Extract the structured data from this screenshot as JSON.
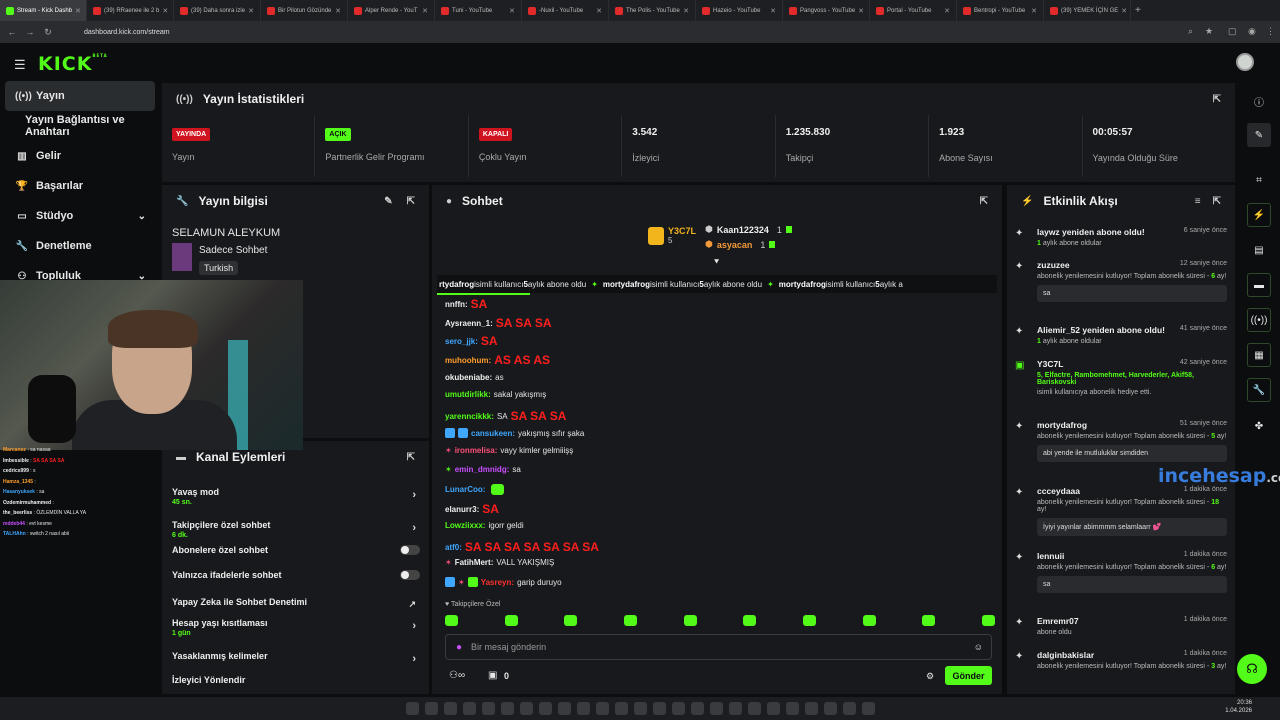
{
  "browser": {
    "tabs": [
      {
        "label": "Stream - Kick Dashb",
        "active": true
      },
      {
        "label": "(39) RRaenee ile 2 b"
      },
      {
        "label": "(39) Daha sonra izle"
      },
      {
        "label": "Bir Pilotun Gözünde"
      },
      {
        "label": "Alper Rende - YouT"
      },
      {
        "label": "Tuni - YouTube"
      },
      {
        "label": "-Nuxil - YouTube"
      },
      {
        "label": "The Polis - YouTube"
      },
      {
        "label": "Hazeio - YouTube"
      },
      {
        "label": "Pangvoss - YouTube"
      },
      {
        "label": "Portal - YouTube"
      },
      {
        "label": "Bentropi - YouTube"
      },
      {
        "label": "(39) YEMEK İÇİN GE"
      }
    ],
    "url": "dashboard.kick.com/stream"
  },
  "header": {
    "logo": "KICK",
    "logo_tag": "BETA"
  },
  "sidebar": {
    "items": [
      {
        "label": "Yayın",
        "icon": "broadcast-icon",
        "active": true
      },
      {
        "label": "Yayın Bağlantısı ve Anahtarı"
      },
      {
        "label": "Gelir",
        "icon": "chart-icon"
      },
      {
        "label": "Başarılar",
        "icon": "trophy-icon"
      },
      {
        "label": "Stüdyo",
        "icon": "monitor-icon",
        "chevron": true
      },
      {
        "label": "Denetleme",
        "icon": "wrench-icon"
      },
      {
        "label": "Topluluk",
        "icon": "people-icon",
        "chevron": true
      }
    ]
  },
  "stats": {
    "title": "Yayın İstatistikleri",
    "cells": [
      {
        "badge": "YAYINDA",
        "label": "Yayın"
      },
      {
        "badge": "AÇIK",
        "label": "Partnerlik Gelir Programı"
      },
      {
        "badge": "KAPALI",
        "label": "Çoklu Yayın"
      },
      {
        "value": "3.542",
        "label": "İzleyici"
      },
      {
        "value": "1.235.830",
        "label": "Takipçi"
      },
      {
        "value": "1.923",
        "label": "Abone Sayısı"
      },
      {
        "value": "00:05:57",
        "label": "Yayında Olduğu Süre"
      }
    ]
  },
  "info": {
    "title": "Yayın bilgisi",
    "stream_title": "SELAMUN ALEYKUM",
    "category": "Sadece Sohbet",
    "language": "Turkish"
  },
  "channel_actions": {
    "title": "Kanal Eylemleri",
    "rows": [
      {
        "label": "Yavaş mod",
        "sub": "45 sn.",
        "type": "arrow"
      },
      {
        "label": "Takipçilere özel sohbet",
        "sub": "6 dk.",
        "type": "arrow"
      },
      {
        "label": "Abonelere özel sohbet",
        "type": "toggle"
      },
      {
        "label": "Yalnızca ifadelerle sohbet",
        "type": "toggle"
      },
      {
        "label": "Yapay Zeka ile Sohbet Denetimi",
        "type": "link"
      },
      {
        "label": "Hesap yaşı kısıtlaması",
        "sub": "1 gün",
        "type": "arrow"
      },
      {
        "label": "Yasaklanmış kelimeler",
        "type": "arrow"
      },
      {
        "label": "İzleyici Yönlendir",
        "type": "none"
      }
    ]
  },
  "chat": {
    "title": "Sohbet",
    "top_gifters": [
      {
        "name": "Y3C7L",
        "count": "5"
      },
      {
        "name": "Kaan122324",
        "count": "1"
      },
      {
        "name": "asyacan",
        "count": "1"
      }
    ],
    "ticker": [
      {
        "user": "rtydafrog",
        "text": " isimli kullanıcı ",
        "months": "5",
        "tail": " aylık abone oldu"
      },
      {
        "user": "mortydafrog",
        "text": " isimli kullanıcı ",
        "months": "5",
        "tail": " aylık abone oldu"
      },
      {
        "user": "mortydafrog",
        "text": " isimli kullanıcı ",
        "months": "5",
        "tail": " aylık a"
      }
    ],
    "messages": [
      {
        "user": "nnffn",
        "color": "#f0f0f0",
        "text": "SA",
        "big": true
      },
      {
        "user": "Aysraenn_1",
        "color": "#f0f0f0",
        "text": "SA SA SA",
        "big": true
      },
      {
        "user": "sero_jjk",
        "color": "#3fa7ff",
        "text": "SA",
        "big": true
      },
      {
        "user": "muhoohum",
        "color": "#ff9e2c",
        "text": "AS AS AS",
        "big": true
      },
      {
        "user": "okubeniabe",
        "color": "#f0f0f0",
        "text": "as"
      },
      {
        "user": "umutdirlikk",
        "color": "#53fc18",
        "text": "sakal yakışmış"
      },
      {
        "user": "yarenncikkk",
        "color": "#53fc18",
        "text": "SA",
        "tail": "SA SA SA"
      },
      {
        "user": "cansukeen",
        "color": "#3fa7ff",
        "text": "yakışmış sıfır şaka"
      },
      {
        "user": "ironmelisa",
        "color": "#ff4f7b",
        "text": "vayy kimler gelmiiişş"
      },
      {
        "user": "emin_dmnidg",
        "color": "#c84fff",
        "text": "sa"
      },
      {
        "user": "LunarCoo",
        "color": "#3fa7ff",
        "text": ""
      },
      {
        "user": "elanurr3",
        "color": "#f0f0f0",
        "text": "SA",
        "big": true
      },
      {
        "user": "Lowziixxx",
        "color": "#53fc18",
        "text": "igorr geldi"
      },
      {
        "user": "atf0",
        "color": "#3fa7ff",
        "text": "SA SA SA SA SA SA SA",
        "big": true
      },
      {
        "user": "FatihMert",
        "color": "#f0f0f0",
        "text": "VALL YAKIŞMIŞ"
      },
      {
        "user": "Yasreyn",
        "color": "#ff2f2f",
        "text": "garip duruyo"
      }
    ],
    "mode_label": "Takipçilere Özel",
    "input_placeholder": "Bir mesaj gönderin",
    "send": "Gönder",
    "count": "0"
  },
  "events": {
    "title": "Etkinlik Akışı",
    "items": [
      {
        "title": "laywz yeniden abone oldu!",
        "time": "6 saniye önce",
        "sub": "1",
        "sub_tail": " aylık abone oldular"
      },
      {
        "title": "zuzuzee",
        "time": "12 saniye önce",
        "sub": "abonelik yenilemesini kutluyor! Toplam abonelik süresi - ",
        "months": "6",
        "tail": " ay!",
        "bubble": "sa"
      },
      {
        "title": "Aliemir_52 yeniden abone oldu!",
        "time": "41 saniye önce",
        "sub": "1",
        "sub_tail": " aylık abone oldular"
      },
      {
        "title": "Y3C7L",
        "time": "42 saniye önce",
        "gift": "5, Elfactre, Rambomehmet, Harvederler, Akif58, Bariskovski",
        "sub": "isimli kullanıcıya abonelik hediye etti."
      },
      {
        "title": "mortydafrog",
        "time": "51 saniye önce",
        "sub": "abonelik yenilemesini kutluyor! Toplam abonelik süresi - ",
        "months": "5",
        "tail": " ay!",
        "bubble": "abi yende ile mutluluklar simdiden"
      },
      {
        "title": "ccceydaaa",
        "time": "1 dakika önce",
        "sub": "abonelik yenilemesini kutluyor! Toplam abonelik süresi - ",
        "months": "18",
        "tail": " ay!",
        "bubble": "İyiyi yayınlar abimmmm selamlaarr 💕"
      },
      {
        "title": "lennuii",
        "time": "1 dakika önce",
        "sub": "abonelik yenilemesini kutluyor! Toplam abonelik süresi - ",
        "months": "6",
        "tail": " ay!",
        "bubble": "sa"
      },
      {
        "title": "Emremr07",
        "time": "1 dakika önce",
        "sub": "abone oldu"
      },
      {
        "title": "dalginbakislar",
        "time": "1 dakika önce",
        "sub": "abonelik yenilemesini kutluyor! Toplam abonelik süresi - ",
        "months": "3",
        "tail": " ay!"
      }
    ]
  },
  "overlay_chat": [
    {
      "user": "Marcanoz",
      "text": "sa nasaa",
      "color": "#ff9e2c"
    },
    {
      "user": "Imbessible",
      "text": "SA SA SA SA",
      "color": "#f0f0f0"
    },
    {
      "user": "cedrics999",
      "text": "s",
      "color": "#f0f0f0"
    },
    {
      "user": "Hamza_1345",
      "text": "",
      "color": "#ff9e2c"
    },
    {
      "user": "Hasanyuksek",
      "text": "sa",
      "color": "#3fa7ff"
    },
    {
      "user": "Ozdemirmuhammed",
      "text": "",
      "color": "#f0f0f0"
    },
    {
      "user": "the_beerliss",
      "text": "ÖZLEMDİN VALLA YA",
      "color": "#f0f0f0"
    },
    {
      "user": "mddeb44",
      "text": "evt kesme",
      "color": "#c84fff"
    },
    {
      "user": "TALHAhn",
      "text": "switch 2 nasıl abii",
      "color": "#3fa7ff"
    }
  ],
  "watermark": {
    "a": "ince",
    "b": "hesap",
    "c": ".com"
  },
  "clock": {
    "time": "20:36",
    "date": "1.04.2026"
  }
}
